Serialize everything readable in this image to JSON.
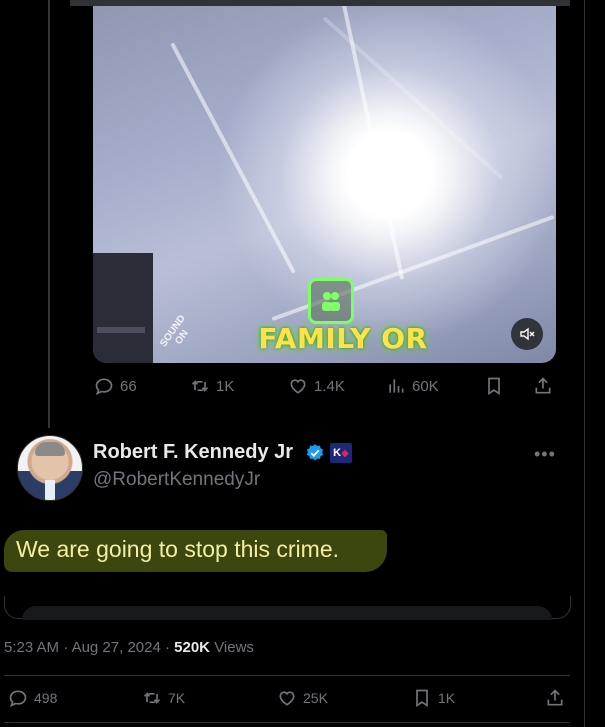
{
  "video": {
    "caption": "FAMILY OR",
    "sound_badge": "SOUND ON",
    "mute_icon": "speaker-mute-icon"
  },
  "quoted_actions": {
    "replies": "66",
    "reposts": "1K",
    "likes": "1.4K",
    "views": "60K"
  },
  "author": {
    "name": "Robert F. Kennedy Jr",
    "handle": "@RobertKennedyJr",
    "badge_text": "K",
    "verified_color": "#1d9bf0"
  },
  "tweet": {
    "text": "We are going to stop this crime."
  },
  "meta": {
    "time": "5:23 AM",
    "date": "Aug 27, 2024",
    "views": "520K",
    "views_label": "Views",
    "separator": "·"
  },
  "actions": {
    "replies": "498",
    "reposts": "7K",
    "likes": "25K",
    "bookmarks": "1K"
  },
  "colors": {
    "accent": "#1d9bf0",
    "muted": "#71767b",
    "highlight": "#3f4a10"
  }
}
